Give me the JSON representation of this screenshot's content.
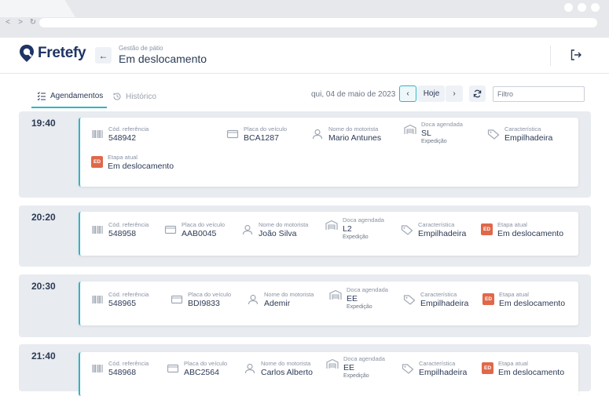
{
  "app": {
    "brand": "Fretefy",
    "breadcrumb": "Gestão de pátio",
    "title": "Em deslocamento"
  },
  "tabs": [
    {
      "label": "Agendamentos"
    },
    {
      "label": "Histórico"
    }
  ],
  "toolbar": {
    "date": "qui, 04 de maio de 2023",
    "today_label": "Hoje",
    "filter_placeholder": "Filtro"
  },
  "labels": {
    "ref": "Cód. referência",
    "plate": "Placa do veículo",
    "driver": "Nome do motorista",
    "dock": "Doca agendada",
    "feature": "Característica",
    "stage": "Etapa atual",
    "badge": "ED"
  },
  "groups": [
    {
      "time": "19:40",
      "ref": "548942",
      "plate": "BCA1287",
      "driver": "Mario Antunes",
      "dock": "SL",
      "dock_type": "Expedição",
      "feature": "Empilhadeira",
      "stage": "Em deslocamento"
    },
    {
      "time": "20:20",
      "ref": "548958",
      "plate": "AAB0045",
      "driver": "João Silva",
      "dock": "L2",
      "dock_type": "Expedição",
      "feature": "Empilhadeira",
      "stage": "Em deslocamento"
    },
    {
      "time": "20:30",
      "ref": "548965",
      "plate": "BDI9833",
      "driver": "Ademir",
      "dock": "EE",
      "dock_type": "Expedição",
      "feature": "Empilhadeira",
      "stage": "Em deslocamento"
    },
    {
      "time": "21:40",
      "ref": "548968",
      "plate": "ABC2564",
      "driver": "Carlos Alberto",
      "dock": "EE",
      "dock_type": "Expedição",
      "feature": "Empilhadeira",
      "stage": "Em deslocamento"
    }
  ],
  "colors": {
    "accent": "#2cb6c9",
    "brand": "#1f3366",
    "badge": "#e0684a"
  }
}
